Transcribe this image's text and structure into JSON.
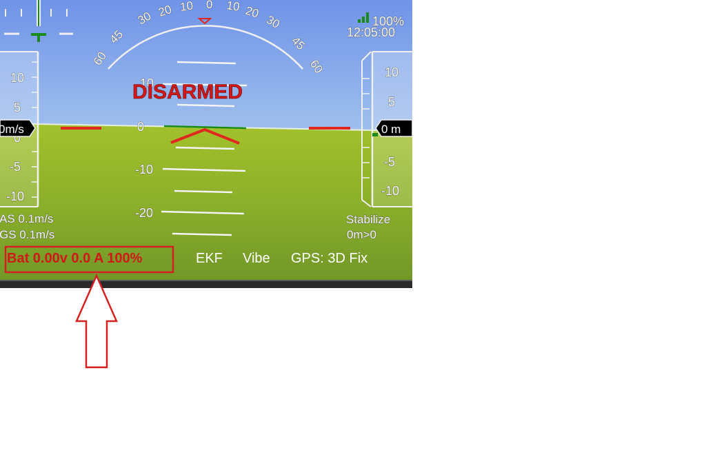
{
  "hud": {
    "arm_state": "DISARMED",
    "battery": {
      "text": "Bat 0.00v 0.0 A 100%"
    },
    "status_items": [
      "EKF",
      "Vibe",
      "GPS: 3D Fix"
    ],
    "link_quality": "100%",
    "clock": "12:05:00",
    "mode": "Stabilize",
    "waypoint": "0m>0",
    "airspeed": "AS 0.1m/s",
    "groundspeed": "GS 0.1m/s",
    "speed_readout": "0m/s",
    "altitude_readout": "0 m",
    "roll_scale": [
      "60",
      "45",
      "30",
      "20",
      "10",
      "0",
      "10",
      "20",
      "30",
      "45",
      "60"
    ],
    "pitch_labels": [
      "10",
      "0",
      "-10",
      "-20"
    ],
    "speed_scale": [
      "10",
      "5",
      "0",
      "-5",
      "-10"
    ],
    "alt_scale": [
      "10",
      "5",
      "0",
      "-5",
      "-10"
    ]
  },
  "colors": {
    "sky_top": "#6f93e8",
    "sky_bottom": "#d7eef2",
    "ground_top": "#9fbf2a",
    "ground_bottom": "#6f9528",
    "warning_red": "#e0281e",
    "annotation_red": "#d42020",
    "level_green": "#1a8a1a"
  },
  "icons": {
    "signal": "signal-bars-icon",
    "roll_pointer": "triangle-pointer-icon"
  }
}
